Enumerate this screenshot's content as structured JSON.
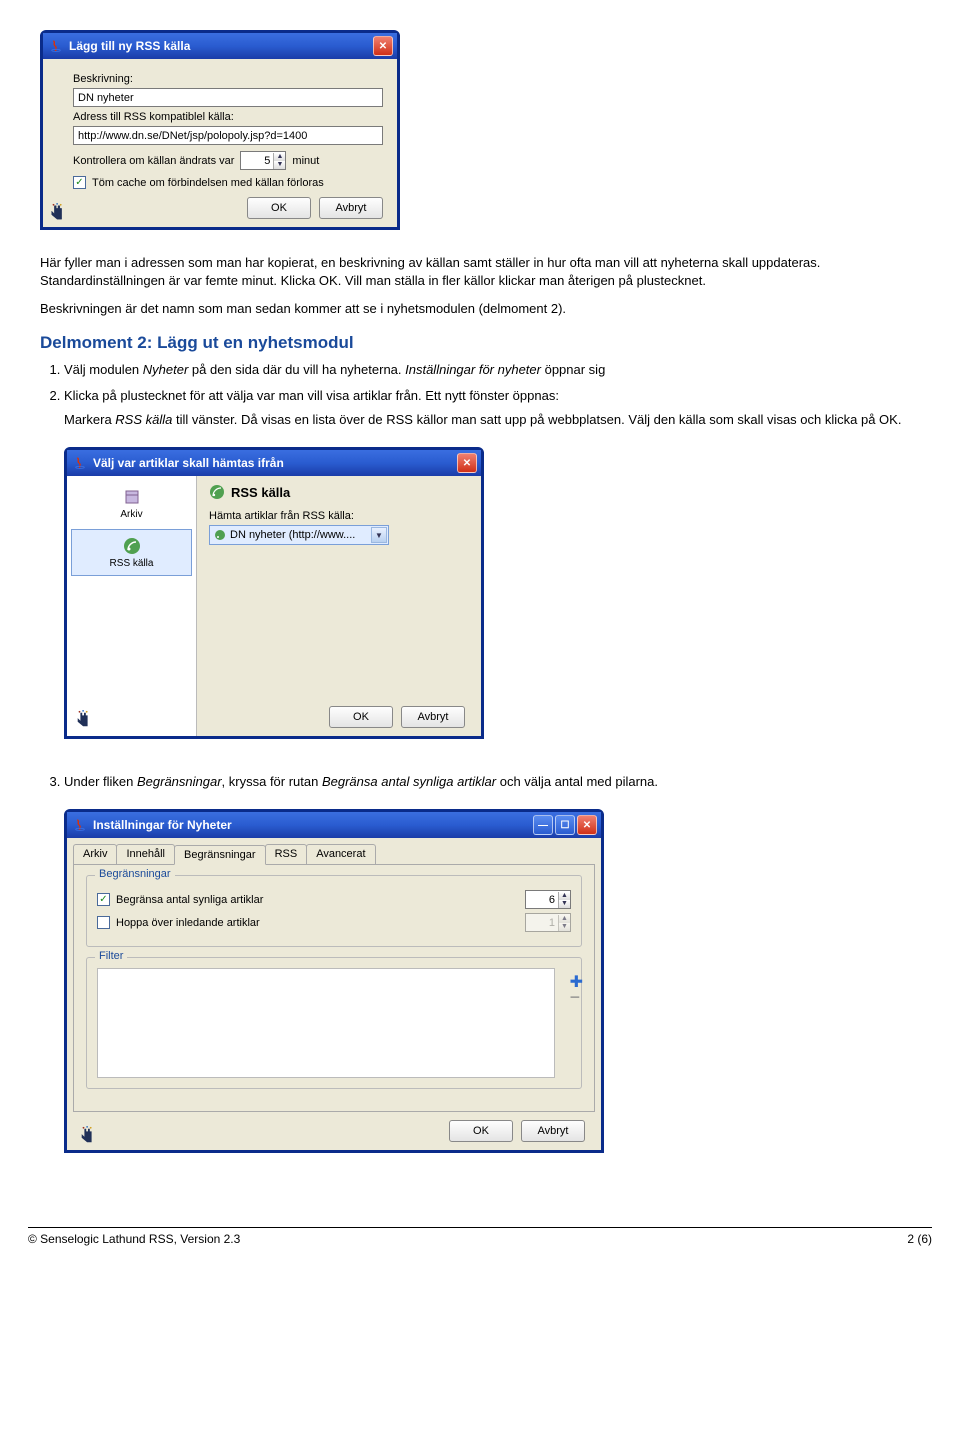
{
  "dialog1": {
    "title": "Lägg till ny RSS källa",
    "desc_label": "Beskrivning:",
    "desc_value": "DN nyheter",
    "addr_label": "Adress till RSS kompatiblel källa:",
    "addr_value": "http://www.dn.se/DNet/jsp/polopoly.jsp?d=1400",
    "check_label_pre": "Kontrollera om källan ändrats var",
    "check_interval": "5",
    "check_label_post": "minut",
    "tomcache_label": "Töm cache om förbindelsen med källan förloras",
    "ok": "OK",
    "cancel": "Avbryt"
  },
  "p1": "Här fyller man i adressen som man har kopierat, en beskrivning av källan samt ställer in hur ofta man vill att nyheterna skall uppdateras. Standardinställningen är var femte minut. Klicka OK. Vill man ställa in fler källor klickar man återigen på plustecknet.",
  "p2": "Beskrivningen är det namn som man sedan kommer att se i nyhetsmodulen (delmoment 2).",
  "heading1": "Delmoment 2: Lägg ut en nyhetsmodul",
  "li1_a": "Välj modulen ",
  "li1_b": "Nyheter",
  "li1_c": " på den sida där du vill ha nyheterna. ",
  "li1_d": "Inställningar för nyheter",
  "li1_e": " öppnar sig",
  "li2_a": "Klicka på plustecknet för att välja var man vill visa artiklar från. Ett nytt fönster öppnas:",
  "li2_b1": "Markera ",
  "li2_b2": "RSS källa",
  "li2_b3": " till vänster. Då visas en lista över de RSS källor man satt upp på webbplatsen. Välj den källa som skall visas och klicka på OK.",
  "dialog2": {
    "title": "Välj var artiklar skall hämtas ifrån",
    "left_archive": "Arkiv",
    "left_rss": "RSS källa",
    "rss_heading": "RSS källa",
    "dropdown_label": "Hämta artiklar från RSS källa:",
    "dropdown_value": "DN nyheter (http://www....",
    "ok": "OK",
    "cancel": "Avbryt"
  },
  "li3_a": "Under fliken ",
  "li3_b": "Begränsningar",
  "li3_c": ", kryssa för rutan ",
  "li3_d": "Begränsa antal synliga artiklar",
  "li3_e": " och välja antal med pilarna.",
  "dialog3": {
    "title": "Inställningar för Nyheter",
    "tabs": [
      "Arkiv",
      "Innehåll",
      "Begränsningar",
      "RSS",
      "Avancerat"
    ],
    "group_label": "Begränsningar",
    "cb1": "Begränsa antal synliga artiklar",
    "cb1_val": "6",
    "cb2": "Hoppa över inledande artiklar",
    "cb2_val": "1",
    "filter_label": "Filter",
    "ok": "OK",
    "cancel": "Avbryt"
  },
  "footer_left": "© Senselogic Lathund RSS, Version 2.3",
  "footer_right": "2 (6)"
}
